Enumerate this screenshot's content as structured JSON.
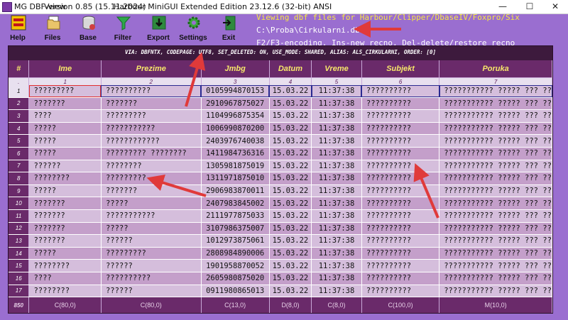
{
  "window": {
    "app": "MG DBF-view",
    "version": "Version 0.85 (15.11.2024)",
    "subtitle": "Harbour MiniGUI Extended Edition 23.12.6 (32-bit) ANSI",
    "minimize": "—",
    "maximize": "☐",
    "close": "✕"
  },
  "toolbar": [
    {
      "label": "Help",
      "icon": "help-icon"
    },
    {
      "label": "Files",
      "icon": "files-icon"
    },
    {
      "label": "Base",
      "icon": "database-icon"
    },
    {
      "label": "Filter",
      "icon": "filter-icon"
    },
    {
      "label": "Export",
      "icon": "export-icon"
    },
    {
      "label": "Settings",
      "icon": "gear-icon"
    },
    {
      "label": "Exit",
      "icon": "exit-icon"
    }
  ],
  "header": {
    "line1": "Viewing dbf files for Harbour/Clipper/DbaseIV/Foxpro/Six",
    "line2": "C:\\Proba\\Cirkularni.dbf",
    "line3": "F2/F3-encoding,   Ins-new recno, Del-delete/restore recno"
  },
  "infobar": "VIA: DBFNTX, CODEPAGE: UTF8, SET_DELETED: ON, USE_MODE: SHARED, ALIAS: ALS_CIRKULARNI, ORDER: [0]",
  "columns": [
    {
      "name": "#",
      "num": "."
    },
    {
      "name": "Ime",
      "num": "1"
    },
    {
      "name": "Prezime",
      "num": "2"
    },
    {
      "name": "Jmbg",
      "num": "3"
    },
    {
      "name": "Datum",
      "num": "4"
    },
    {
      "name": "Vreme",
      "num": "5"
    },
    {
      "name": "Subjekt",
      "num": "6"
    },
    {
      "name": "Poruka",
      "num": "7"
    }
  ],
  "rows": [
    [
      "1",
      "?????????",
      "??????????",
      "0105994870153",
      "15.03.22",
      "11:37:38",
      "??????????",
      "??????????? ????? ??? ??"
    ],
    [
      "2",
      "???????",
      "???????",
      "2910967875027",
      "15.03.22",
      "11:37:38",
      "??????????",
      "??????????? ????? ??? ??"
    ],
    [
      "3",
      "????",
      "?????????",
      "1104996875354",
      "15.03.22",
      "11:37:38",
      "??????????",
      "??????????? ????? ??? ??"
    ],
    [
      "4",
      "?????",
      "???????????",
      "1006990870200",
      "15.03.22",
      "11:37:38",
      "??????????",
      "??????????? ????? ??? ??"
    ],
    [
      "5",
      "?????",
      "????????????",
      "2403976740038",
      "15.03.22",
      "11:37:38",
      "??????????",
      "??????????? ????? ??? ??"
    ],
    [
      "6",
      "?????",
      "????????? ????????",
      "1411984736316",
      "15.03.22",
      "11:37:38",
      "??????????",
      "??????????? ????? ??? ??"
    ],
    [
      "7",
      "??????",
      "????????",
      "1305981875019",
      "15.03.22",
      "11:37:38",
      "??????????",
      "??????????? ????? ??? ??"
    ],
    [
      "8",
      "????????",
      "?????????",
      "1311971875010",
      "15.03.22",
      "11:37:38",
      "??????????",
      "??????????? ????? ??? ??"
    ],
    [
      "9",
      "?????",
      "???????",
      "2906983870011",
      "15.03.22",
      "11:37:38",
      "??????????",
      "??????????? ????? ??? ??"
    ],
    [
      "10",
      "???????",
      "?????",
      "2407983845002",
      "15.03.22",
      "11:37:38",
      "??????????",
      "??????????? ????? ??? ??"
    ],
    [
      "11",
      "???????",
      "???????????",
      "2111977875033",
      "15.03.22",
      "11:37:38",
      "??????????",
      "??????????? ????? ??? ??"
    ],
    [
      "12",
      "???????",
      "?????",
      "3107986375007",
      "15.03.22",
      "11:37:38",
      "??????????",
      "??????????? ????? ??? ??"
    ],
    [
      "13",
      "???????",
      "??????",
      "1012973875061",
      "15.03.22",
      "11:37:38",
      "??????????",
      "??????????? ????? ??? ??"
    ],
    [
      "14",
      "?????",
      "?????????",
      "2808984890006",
      "15.03.22",
      "11:37:38",
      "??????????",
      "??????????? ????? ??? ??"
    ],
    [
      "15",
      "????????",
      "??????",
      "1901958870052",
      "15.03.22",
      "11:37:38",
      "??????????",
      "??????????? ????? ??? ??"
    ],
    [
      "16",
      "????",
      "??????????",
      "2605980875020",
      "15.03.22",
      "11:37:38",
      "??????????",
      "??????????? ????? ??? ??"
    ],
    [
      "17",
      "????????",
      "??????",
      "0911980865013",
      "15.03.22",
      "11:37:38",
      "??????????",
      "??????????? ????? ??? ??"
    ]
  ],
  "footer": [
    "850",
    "C(80,0)",
    "C(80,0)",
    "C(13,0)",
    "D(8,0)",
    "C(8,0)",
    "C(100,0)",
    "M(10,0)"
  ],
  "colors": {
    "accent": "#9a6ed0",
    "header_bg": "#6a2a6a",
    "header_text": "#f7e76a",
    "arrow": "#e03a3a"
  }
}
